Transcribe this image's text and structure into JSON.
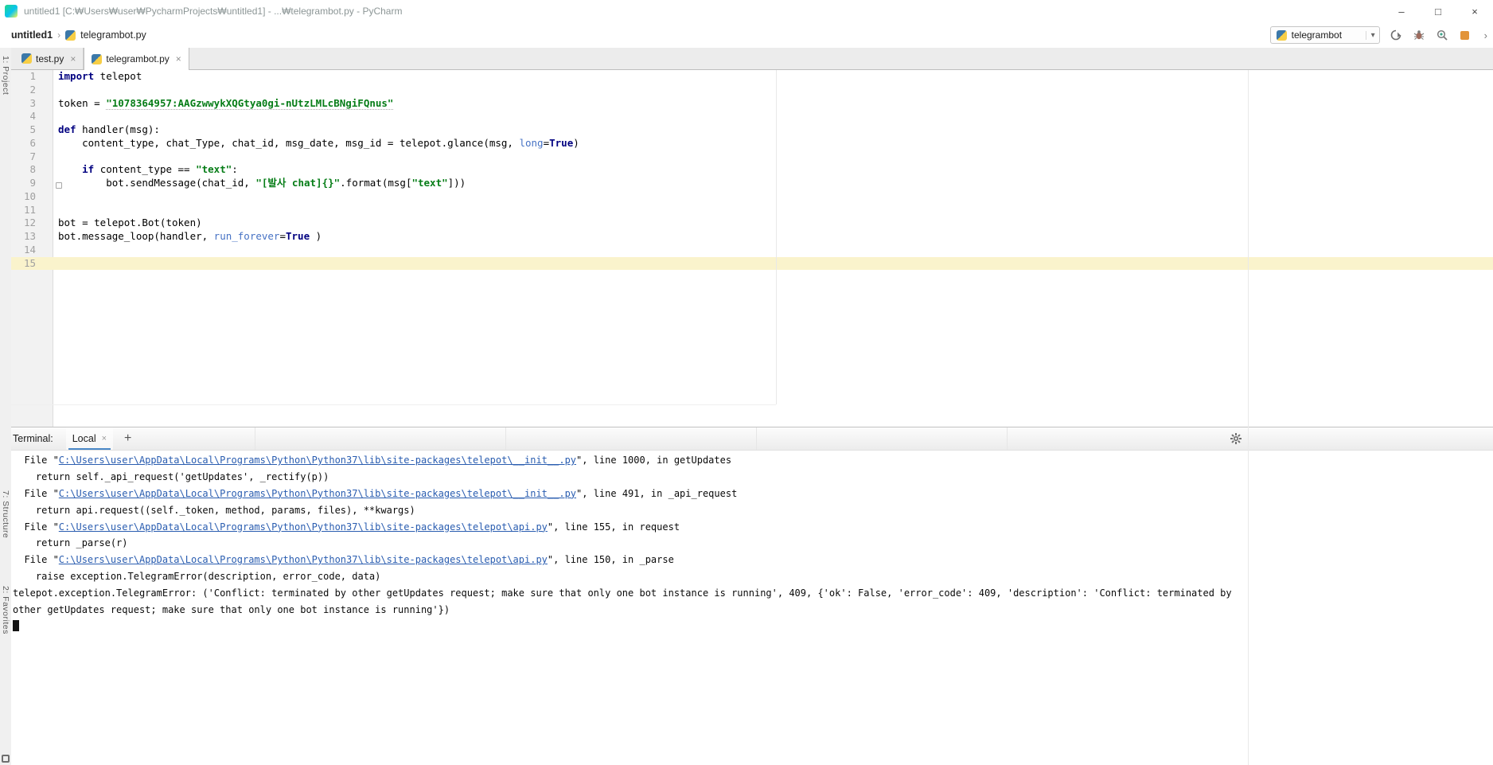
{
  "titlebar": {
    "title": "untitled1 [C:₩Users₩user₩PycharmProjects₩untitled1] - ...₩telegrambot.py - PyCharm"
  },
  "icons": {
    "breadcrumb_sep": "›",
    "combo_arrow": "▾",
    "tab_close": "×",
    "terminal_tab_close": "×",
    "add_terminal": "+",
    "minimize": "–",
    "maximize": "□",
    "close": "×",
    "overflow": "›",
    "fold_open": "▾"
  },
  "colors": {
    "caret_row": "#FAF3CC",
    "keyword": "#000080",
    "string": "#067D17",
    "keyword_argument": "#4672C4",
    "terminal_link": "#2A5DB0",
    "terminal_tab_underline": "#4A88C7",
    "stop_square": "#E2943A"
  },
  "navbar": {
    "project": "untitled1",
    "file": "telegrambot.py",
    "run_config": "telegrambot"
  },
  "tabs": [
    {
      "label": "test.py",
      "active": false
    },
    {
      "label": "telegrambot.py",
      "active": true
    }
  ],
  "stripe": {
    "project": "1: Project",
    "structure": "7: Structure",
    "favorites": "2: Favorites"
  },
  "editor": {
    "lines": [
      {
        "n": 1,
        "seg": [
          [
            "kw",
            "import"
          ],
          [
            "p",
            " telepot"
          ]
        ]
      },
      {
        "n": 2,
        "seg": []
      },
      {
        "n": 3,
        "seg": [
          [
            "p",
            "token = "
          ],
          [
            "stru",
            "\"1078364957:AAGzwwykXQGtya0gi-nUtzLMLcBNgiFQnus\""
          ]
        ]
      },
      {
        "n": 4,
        "seg": []
      },
      {
        "n": 5,
        "seg": [
          [
            "kw",
            "def"
          ],
          [
            "p",
            " handler(msg):"
          ]
        ],
        "fold": "open"
      },
      {
        "n": 6,
        "seg": [
          [
            "p",
            "    content_type, chat_Type, chat_id, msg_date, msg_id = telepot.glance(msg, "
          ],
          [
            "kwarg",
            "long"
          ],
          [
            "p",
            "="
          ],
          [
            "kw",
            "True"
          ],
          [
            "p",
            ")"
          ]
        ]
      },
      {
        "n": 7,
        "seg": []
      },
      {
        "n": 8,
        "seg": [
          [
            "p",
            "    "
          ],
          [
            "kw",
            "if"
          ],
          [
            "p",
            " content_type == "
          ],
          [
            "str",
            "\"text\""
          ],
          [
            "p",
            ":"
          ]
        ]
      },
      {
        "n": 9,
        "seg": [
          [
            "p",
            "        bot.sendMessage(chat_id, "
          ],
          [
            "str",
            "\"[발사 chat]{}\""
          ],
          [
            "p",
            ".format(msg["
          ],
          [
            "str",
            "\"text\""
          ],
          [
            "p",
            "]))"
          ]
        ],
        "fold": "square"
      },
      {
        "n": 10,
        "seg": []
      },
      {
        "n": 11,
        "seg": []
      },
      {
        "n": 12,
        "seg": [
          [
            "p",
            "bot = telepot.Bot(token)"
          ]
        ]
      },
      {
        "n": 13,
        "seg": [
          [
            "p",
            "bot.message_loop(handler, "
          ],
          [
            "kwarg",
            "run_forever"
          ],
          [
            "p",
            "="
          ],
          [
            "kw",
            "True"
          ],
          [
            "p",
            " )"
          ]
        ]
      },
      {
        "n": 14,
        "seg": []
      },
      {
        "n": 15,
        "seg": [],
        "current": true
      }
    ]
  },
  "terminal": {
    "label": "Terminal:",
    "tab": "Local",
    "lines": [
      {
        "seg": [
          [
            "p",
            "  File \""
          ],
          [
            "link",
            "C:\\Users\\user\\AppData\\Local\\Programs\\Python\\Python37\\lib\\site-packages\\telepot\\__init__.py"
          ],
          [
            "p",
            "\", line 1000, in getUpdates"
          ]
        ]
      },
      {
        "seg": [
          [
            "p",
            "    return self._api_request('getUpdates', _rectify(p))"
          ]
        ]
      },
      {
        "seg": [
          [
            "p",
            "  File \""
          ],
          [
            "link",
            "C:\\Users\\user\\AppData\\Local\\Programs\\Python\\Python37\\lib\\site-packages\\telepot\\__init__.py"
          ],
          [
            "p",
            "\", line 491, in _api_request"
          ]
        ]
      },
      {
        "seg": [
          [
            "p",
            "    return api.request((self._token, method, params, files), **kwargs)"
          ]
        ]
      },
      {
        "seg": [
          [
            "p",
            "  File \""
          ],
          [
            "link",
            "C:\\Users\\user\\AppData\\Local\\Programs\\Python\\Python37\\lib\\site-packages\\telepot\\api.py"
          ],
          [
            "p",
            "\", line 155, in request"
          ]
        ]
      },
      {
        "seg": [
          [
            "p",
            "    return _parse(r)"
          ]
        ]
      },
      {
        "seg": [
          [
            "p",
            "  File \""
          ],
          [
            "link",
            "C:\\Users\\user\\AppData\\Local\\Programs\\Python\\Python37\\lib\\site-packages\\telepot\\api.py"
          ],
          [
            "p",
            "\", line 150, in _parse"
          ]
        ]
      },
      {
        "seg": [
          [
            "p",
            "    raise exception.TelegramError(description, error_code, data)"
          ]
        ]
      },
      {
        "seg": [
          [
            "p",
            "telepot.exception.TelegramError: ('Conflict: terminated by other getUpdates request; make sure that only one bot instance is running', 409, {'ok': False, 'error_code': 409, 'description': 'Conflict: terminated by"
          ]
        ]
      },
      {
        "seg": [
          [
            "p",
            "other getUpdates request; make sure that only one bot instance is running'})"
          ]
        ]
      },
      {
        "seg": [
          [
            "cursor",
            ""
          ]
        ]
      }
    ]
  }
}
